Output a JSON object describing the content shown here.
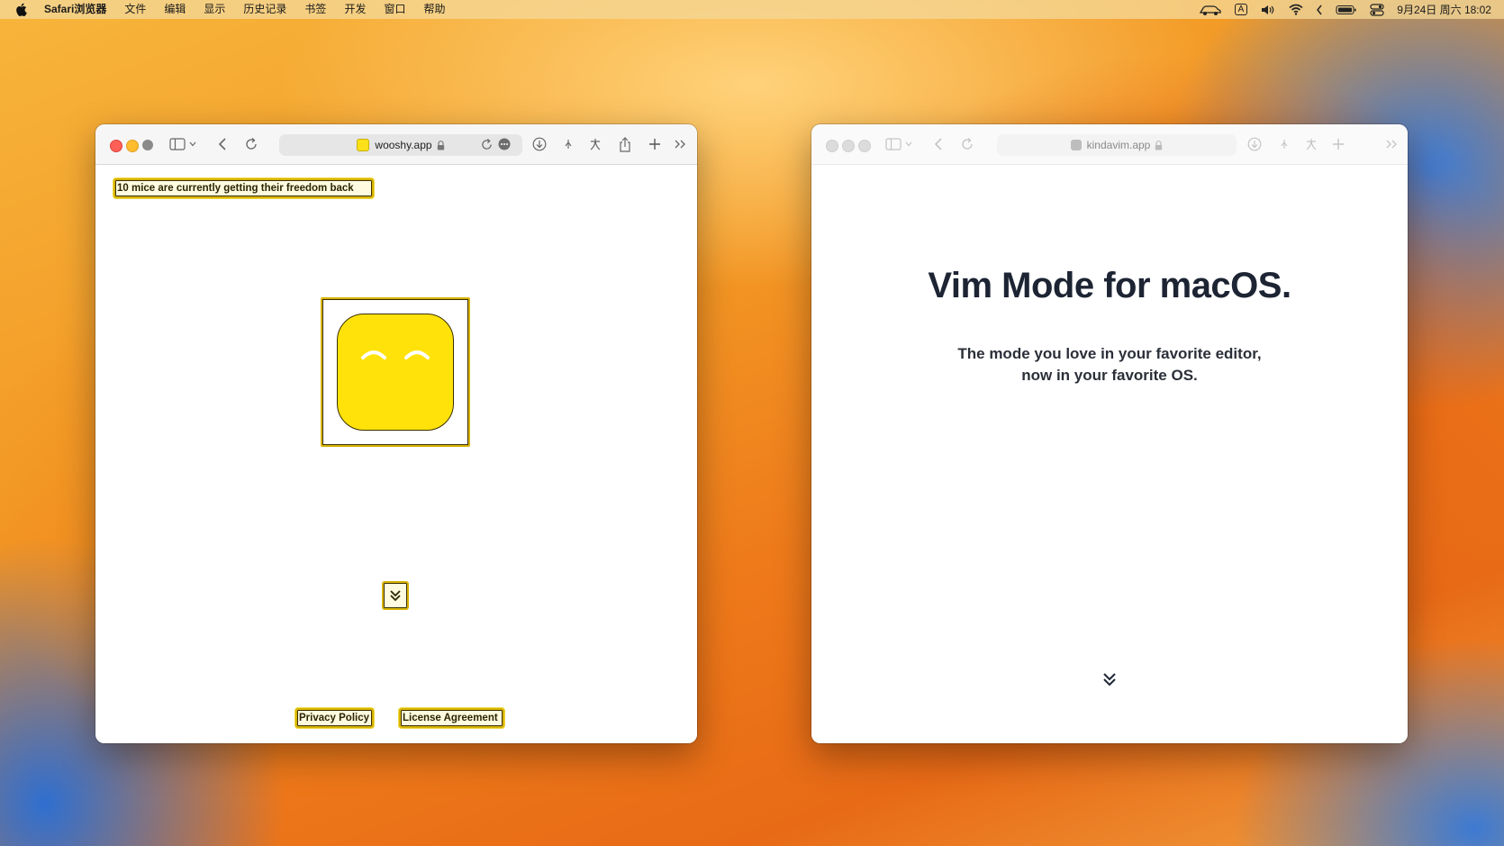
{
  "menubar": {
    "app_name": "Safari浏览器",
    "items": [
      "文件",
      "编辑",
      "显示",
      "历史记录",
      "书签",
      "开发",
      "窗口",
      "帮助"
    ],
    "input_method": "A",
    "clock": "9月24日 周六  18:02"
  },
  "left_window": {
    "url": "wooshy.app",
    "banner": "10 mice are currently getting their freedom back",
    "footer_links": [
      "Privacy Policy",
      "License Agreement"
    ]
  },
  "right_window": {
    "url": "kindavim.app",
    "headline": "Vim Mode for macOS.",
    "subtitle_line1": "The mode you love in your favorite editor,",
    "subtitle_line2": "now in your favorite OS."
  },
  "icons": [
    "apple-icon",
    "car-icon",
    "volume-icon",
    "wifi-icon",
    "chevron-left-icon",
    "battery-icon",
    "control-center-icon",
    "sidebar-icon",
    "back-icon",
    "reload-icon",
    "lock-icon",
    "download-icon",
    "share-icon",
    "plus-icon",
    "overflow-icon",
    "double-chevron-down-icon"
  ],
  "colors": {
    "accent_yellow": "#ffe20a",
    "outline_gold": "#d7b300",
    "traffic_red": "#fe5f57",
    "traffic_yellow": "#febc2e"
  }
}
